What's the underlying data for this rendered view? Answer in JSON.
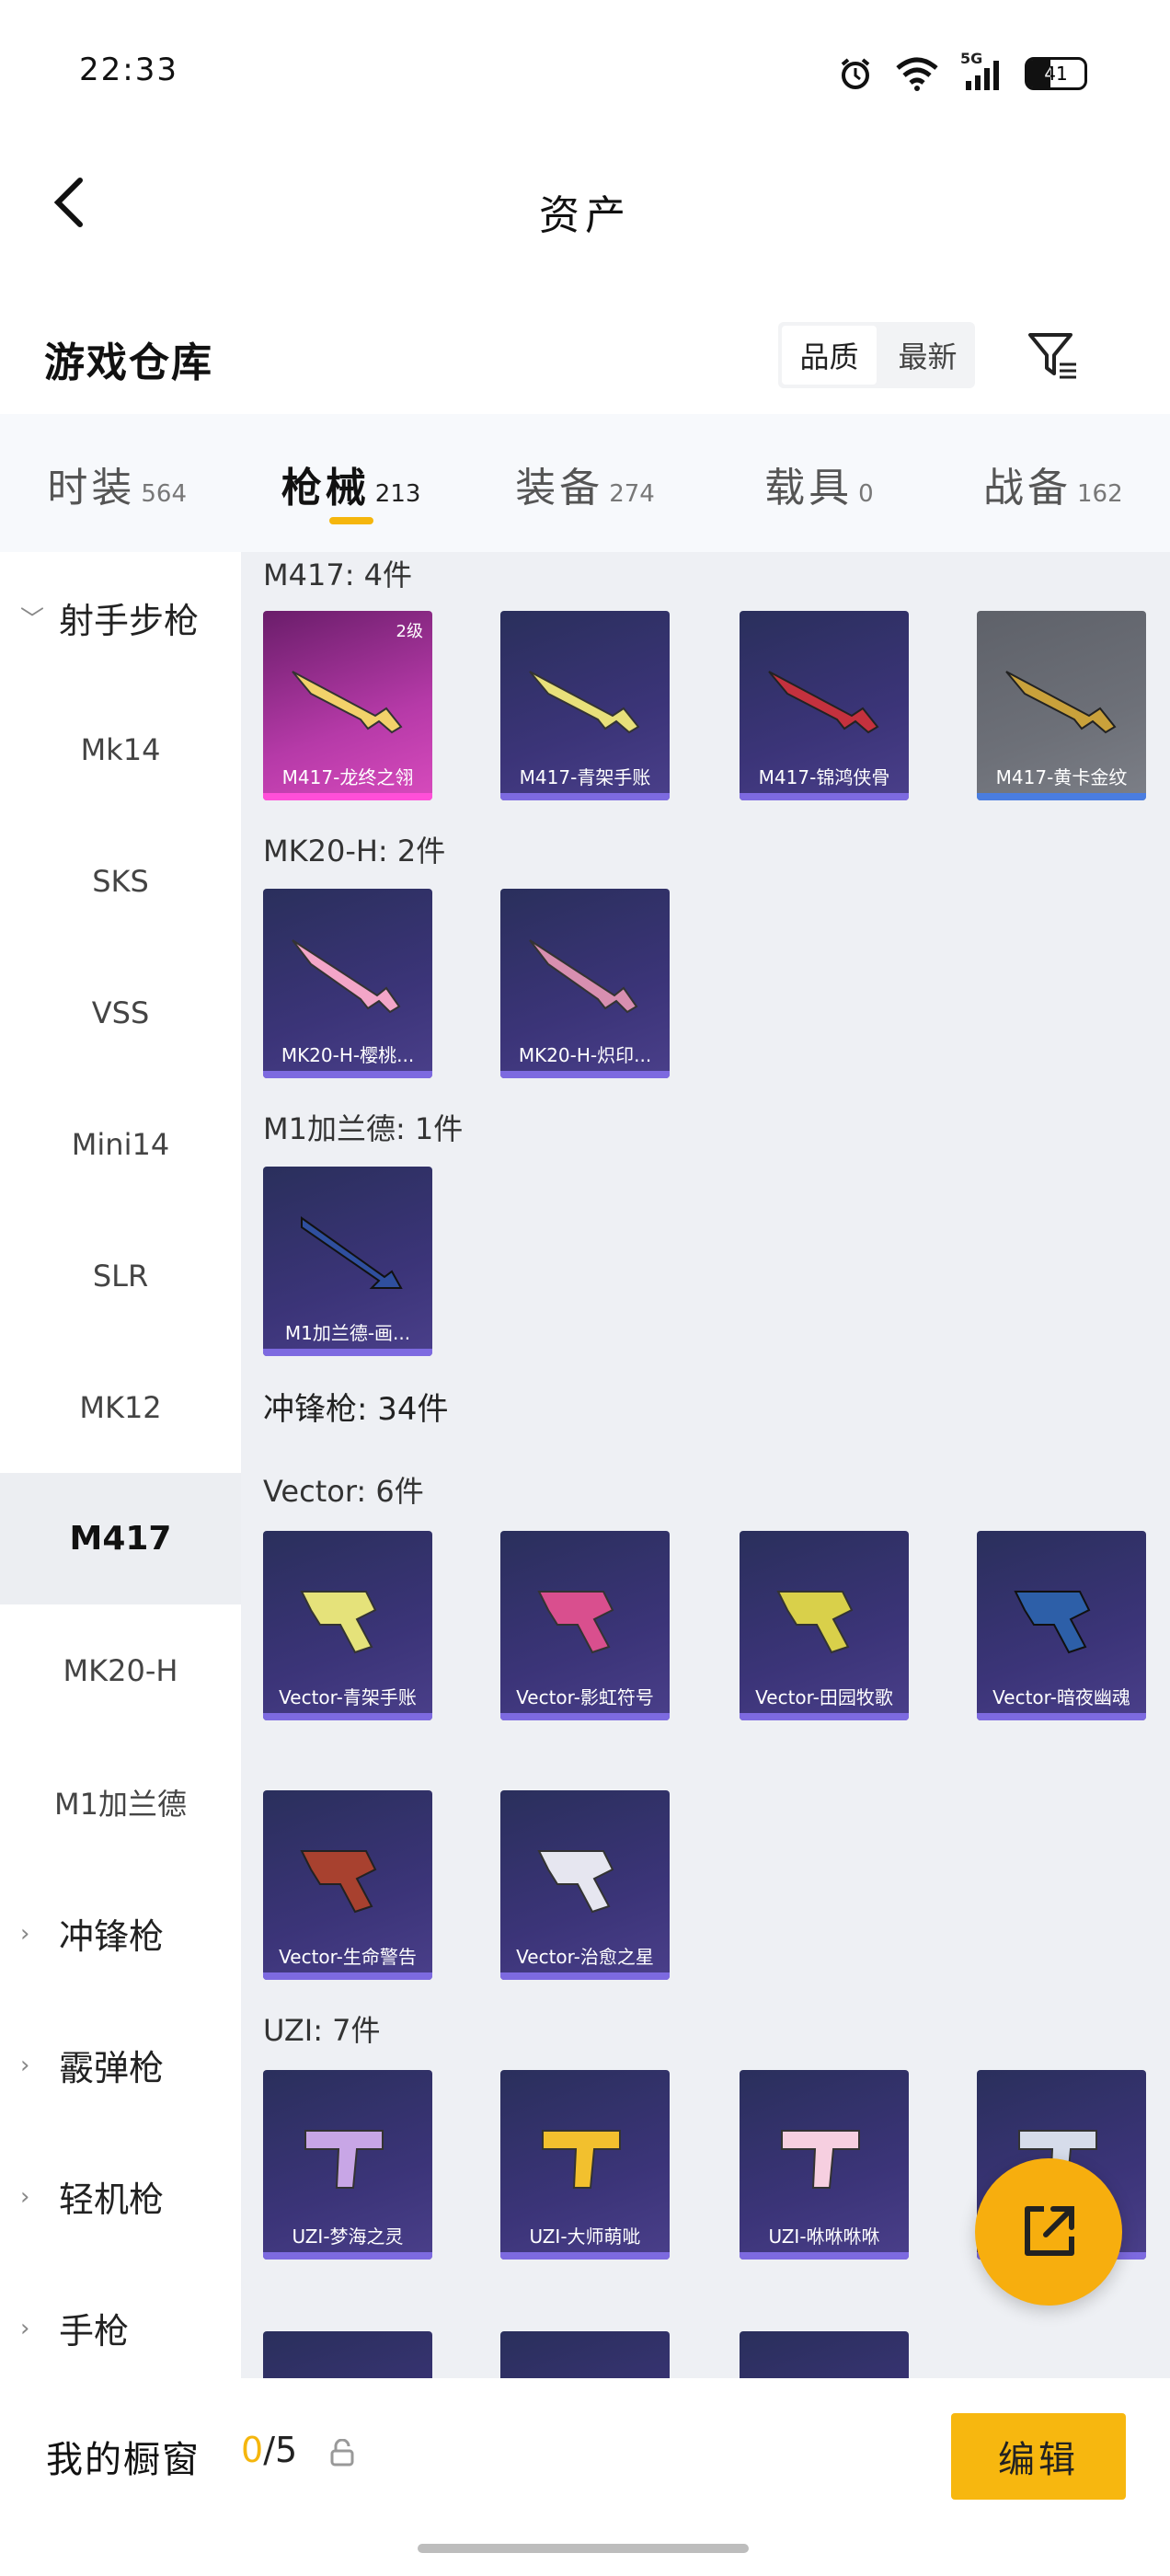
{
  "status_bar": {
    "time": "22:33",
    "battery": "41",
    "network": "5G"
  },
  "header": {
    "title": "资产"
  },
  "warehouse": {
    "title": "游戏仓库",
    "sort_options": [
      "品质",
      "最新"
    ],
    "active_sort": 0
  },
  "tabs": [
    {
      "label": "时装",
      "count": "564"
    },
    {
      "label": "枪械",
      "count": "213"
    },
    {
      "label": "装备",
      "count": "274"
    },
    {
      "label": "载具",
      "count": "0"
    },
    {
      "label": "战备",
      "count": "162"
    }
  ],
  "active_tab": 1,
  "sidebar": {
    "group_title": "射手步枪",
    "items": [
      "Mk14",
      "SKS",
      "VSS",
      "Mini14",
      "SLR",
      "MK12",
      "M417",
      "MK20-H",
      "M1加兰德"
    ],
    "active_item": "M417",
    "collapsed_groups": [
      "冲锋枪",
      "霰弹枪",
      "轻机枪",
      "手枪"
    ]
  },
  "sections": {
    "m417": {
      "title": "M417: 4件",
      "cards": [
        {
          "name": "M417-龙终之翎",
          "tag": "2级",
          "style": "pink"
        },
        {
          "name": "M417-青架手账",
          "style": "purple"
        },
        {
          "name": "M417-锦鸿侠骨",
          "style": "purple"
        },
        {
          "name": "M417-黄卡金纹",
          "style": "gray"
        }
      ]
    },
    "mk20h": {
      "title": "MK20-H: 2件",
      "cards": [
        {
          "name": "MK20-H-樱桃...",
          "style": "purple"
        },
        {
          "name": "MK20-H-炽印...",
          "style": "purple"
        }
      ]
    },
    "m1": {
      "title": "M1加兰德: 1件",
      "cards": [
        {
          "name": "M1加兰德-画...",
          "style": "purple"
        }
      ]
    },
    "smg_header": "冲锋枪: 34件",
    "vector": {
      "title": "Vector: 6件",
      "cards": [
        {
          "name": "Vector-青架手账",
          "style": "purple"
        },
        {
          "name": "Vector-影虹符号",
          "style": "purple"
        },
        {
          "name": "Vector-田园牧歌",
          "style": "purple"
        },
        {
          "name": "Vector-暗夜幽魂",
          "style": "purple"
        },
        {
          "name": "Vector-生命警告",
          "style": "purple"
        },
        {
          "name": "Vector-治愈之星",
          "style": "purple"
        }
      ]
    },
    "uzi": {
      "title": "UZI: 7件",
      "cards": [
        {
          "name": "UZI-梦海之灵",
          "style": "purple"
        },
        {
          "name": "UZI-大师萌呲",
          "style": "purple"
        },
        {
          "name": "UZI-咻咻咻咻",
          "style": "purple"
        },
        {
          "name": "",
          "style": "purple"
        }
      ]
    }
  },
  "bottom_bar": {
    "label": "我的橱窗",
    "current": "0",
    "total": "/5",
    "edit_label": "编辑"
  },
  "colors": {
    "accent": "#f5b60d",
    "card_purple": "#3b3478",
    "card_pink": "#b63aa8"
  }
}
